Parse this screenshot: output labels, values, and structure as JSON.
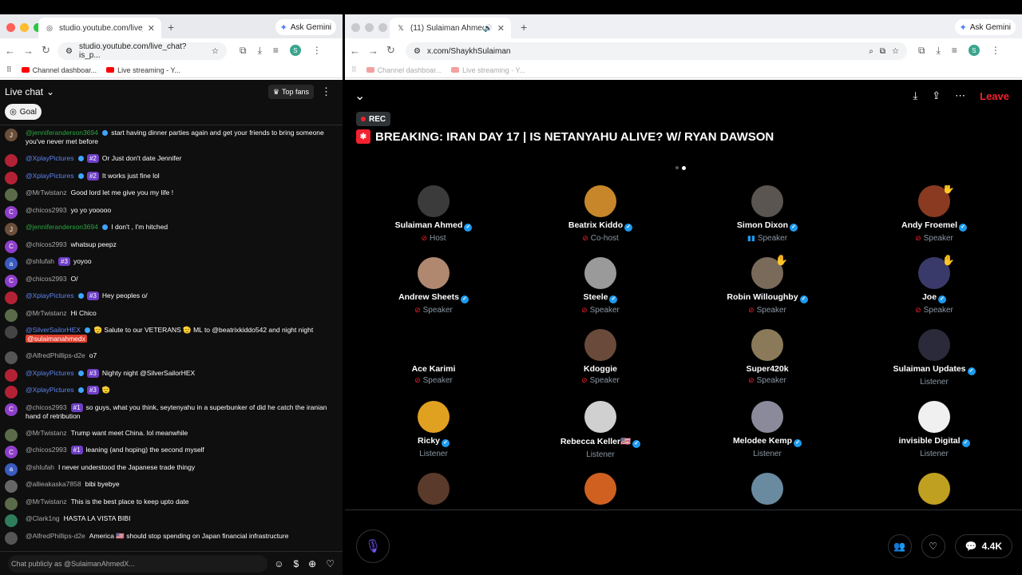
{
  "left_browser": {
    "tab_title": "studio.youtube.com/live_chat",
    "ask_gemini": "Ask Gemini",
    "url": "studio.youtube.com/live_chat?is_p...",
    "bookmarks": [
      "Channel dashboar...",
      "Live streaming - Y..."
    ]
  },
  "chat": {
    "header": "Live chat",
    "top_fans": "Top fans",
    "goal": "Goal",
    "input_placeholder": "Chat publicly as @SulaimanAhmedX...",
    "messages": [
      {
        "initial": "J",
        "color": "#6b4f3a",
        "author": "@jenniferanderson3694",
        "author_style": "green",
        "rank": "",
        "text": "start having dinner parties again and get your friends to bring someone you've never met before"
      },
      {
        "initial": "",
        "color": "#b22234",
        "author": "@XplayPictures",
        "author_style": "blue",
        "rank": "#2",
        "text": "Or Just don't date Jennifer"
      },
      {
        "initial": "",
        "color": "#b22234",
        "author": "@XplayPictures",
        "author_style": "blue",
        "rank": "#2",
        "text": "It works just fine lol"
      },
      {
        "initial": "",
        "color": "#5a6b4a",
        "author": "@MrTwistanz",
        "author_style": "",
        "rank": "",
        "text": "Good lord let me give you my life !"
      },
      {
        "initial": "C",
        "color": "#8e3fc9",
        "author": "@chicos2993",
        "author_style": "",
        "rank": "",
        "text": "yo yo yooooo"
      },
      {
        "initial": "J",
        "color": "#6b4f3a",
        "author": "@jenniferanderson3694",
        "author_style": "green",
        "rank": "",
        "text": "I don't , I'm hitched"
      },
      {
        "initial": "C",
        "color": "#8e3fc9",
        "author": "@chicos2993",
        "author_style": "",
        "rank": "",
        "text": "whatsup peepz"
      },
      {
        "initial": "a",
        "color": "#3a5bbf",
        "author": "@shlufah",
        "author_style": "",
        "rank": "#3",
        "text": "yoyoo"
      },
      {
        "initial": "C",
        "color": "#8e3fc9",
        "author": "@chicos2993",
        "author_style": "",
        "rank": "",
        "text": "O/"
      },
      {
        "initial": "",
        "color": "#b22234",
        "author": "@XplayPictures",
        "author_style": "blue",
        "rank": "#3",
        "text": "Hey peoples o/"
      },
      {
        "initial": "",
        "color": "#5a6b4a",
        "author": "@MrTwistanz",
        "author_style": "",
        "rank": "",
        "text": "Hi Chico"
      },
      {
        "initial": "",
        "color": "#444",
        "author": "@SilverSailorHEX",
        "author_style": "blue",
        "rank": "",
        "text": "🫡 Salute to our VETERANS 🫡 ML to @beatrixkiddo542 and night night",
        "mention": "@sulaimanahmedx"
      },
      {
        "initial": "",
        "color": "#555",
        "author": "@AlfredPhillips-d2e",
        "author_style": "",
        "rank": "",
        "text": "o7"
      },
      {
        "initial": "",
        "color": "#b22234",
        "author": "@XplayPictures",
        "author_style": "blue",
        "rank": "#3",
        "text": "Nighty night @SilverSailorHEX"
      },
      {
        "initial": "",
        "color": "#b22234",
        "author": "@XplayPictures",
        "author_style": "blue",
        "rank": "#3",
        "text": "🫡"
      },
      {
        "initial": "C",
        "color": "#8e3fc9",
        "author": "@chicos2993",
        "author_style": "",
        "rank": "#1",
        "text": "so guys, what you think, seytenyahu in a superbunker of did he catch the iranian hand of retribution"
      },
      {
        "initial": "",
        "color": "#5a6b4a",
        "author": "@MrTwistanz",
        "author_style": "",
        "rank": "",
        "text": "Trump want meet China. lol meanwhile"
      },
      {
        "initial": "C",
        "color": "#8e3fc9",
        "author": "@chicos2993",
        "author_style": "",
        "rank": "#1",
        "text": "leaning (and hoping) the second myself"
      },
      {
        "initial": "a",
        "color": "#3a5bbf",
        "author": "@shlufah",
        "author_style": "",
        "rank": "",
        "text": "I never understood the Japanese trade thingy"
      },
      {
        "initial": "",
        "color": "#666",
        "author": "@allieakaska7858",
        "author_style": "",
        "rank": "",
        "text": "bibi byebye"
      },
      {
        "initial": "",
        "color": "#5a6b4a",
        "author": "@MrTwistanz",
        "author_style": "",
        "rank": "",
        "text": "This is the best place to keep upto date"
      },
      {
        "initial": "",
        "color": "#2e7d5b",
        "author": "@Clark1ng",
        "author_style": "",
        "rank": "",
        "text": "HASTA LA VISTA BIBI"
      },
      {
        "initial": "",
        "color": "#555",
        "author": "@AlfredPhillips-d2e",
        "author_style": "",
        "rank": "",
        "text": "America 🇺🇸 should stop spending on Japan financial infrastructure"
      }
    ]
  },
  "right_browser": {
    "tab_title": "(11) Sulaiman Ahmed (@S",
    "ask_gemini": "Ask Gemini",
    "url": "x.com/ShaykhSulaiman",
    "bookmarks": [
      "Channel dashboar...",
      "Live streaming - Y..."
    ]
  },
  "space": {
    "rec": "REC",
    "leave": "Leave",
    "title": "BREAKING: IRAN DAY 17 | IS NETANYAHU ALIVE? W/ RYAN DAWSON",
    "listener_count": "4.4K",
    "participants": [
      {
        "name": "Sulaiman Ahmed",
        "verified": true,
        "role": "Host",
        "state": "muted",
        "color": "#3b3b3b",
        "hand": false
      },
      {
        "name": "Beatrix Kiddo",
        "verified": true,
        "role": "Co-host",
        "state": "muted",
        "color": "#c8862a",
        "hand": false
      },
      {
        "name": "Simon Dixon",
        "verified": true,
        "role": "Speaker",
        "state": "speaking",
        "color": "#5a5550",
        "hand": false
      },
      {
        "name": "Andy Froemel",
        "verified": true,
        "role": "Speaker",
        "state": "muted",
        "color": "#8a3a20",
        "hand": true
      },
      {
        "name": "Andrew Sheets",
        "verified": true,
        "role": "Speaker",
        "state": "muted",
        "color": "#b08870",
        "hand": false
      },
      {
        "name": "Steele",
        "verified": true,
        "role": "Speaker",
        "state": "muted",
        "color": "#9a9a9a",
        "hand": false
      },
      {
        "name": "Robin Willoughby",
        "verified": true,
        "role": "Speaker",
        "state": "muted",
        "color": "#7a6a5a",
        "hand": true
      },
      {
        "name": "Joe",
        "verified": true,
        "role": "Speaker",
        "state": "muted",
        "color": "#3a3a6a",
        "hand": true
      },
      {
        "name": "Ace Karimi",
        "verified": false,
        "role": "Speaker",
        "state": "muted",
        "color": "#000000",
        "hand": false
      },
      {
        "name": "Kdoggie",
        "verified": false,
        "role": "Speaker",
        "state": "muted",
        "color": "#6a4a3a",
        "hand": false
      },
      {
        "name": "Super420k",
        "verified": false,
        "role": "Speaker",
        "state": "muted",
        "color": "#8a7a5a",
        "hand": false
      },
      {
        "name": "Sulaiman Updates",
        "verified": true,
        "role": "Listener",
        "state": "",
        "color": "#2a2a3a",
        "hand": false
      },
      {
        "name": "Ricky",
        "verified": true,
        "role": "Listener",
        "state": "",
        "color": "#e0a020",
        "hand": false
      },
      {
        "name": "Rebecca Keller🇺🇸",
        "verified": true,
        "role": "Listener",
        "state": "",
        "color": "#d0d0d0",
        "hand": false
      },
      {
        "name": "Melodee Kemp",
        "verified": true,
        "role": "Listener",
        "state": "",
        "color": "#8a8a9a",
        "hand": false
      },
      {
        "name": "invisible Digital",
        "verified": true,
        "role": "Listener",
        "state": "",
        "color": "#f0f0f0",
        "hand": false
      },
      {
        "name": "",
        "verified": false,
        "role": "",
        "state": "",
        "color": "#5a3a2a",
        "hand": false
      },
      {
        "name": "",
        "verified": false,
        "role": "",
        "state": "",
        "color": "#d06020",
        "hand": false
      },
      {
        "name": "",
        "verified": false,
        "role": "",
        "state": "",
        "color": "#6a8aa0",
        "hand": false
      },
      {
        "name": "",
        "verified": false,
        "role": "",
        "state": "",
        "color": "#c0a020",
        "hand": false
      }
    ]
  }
}
